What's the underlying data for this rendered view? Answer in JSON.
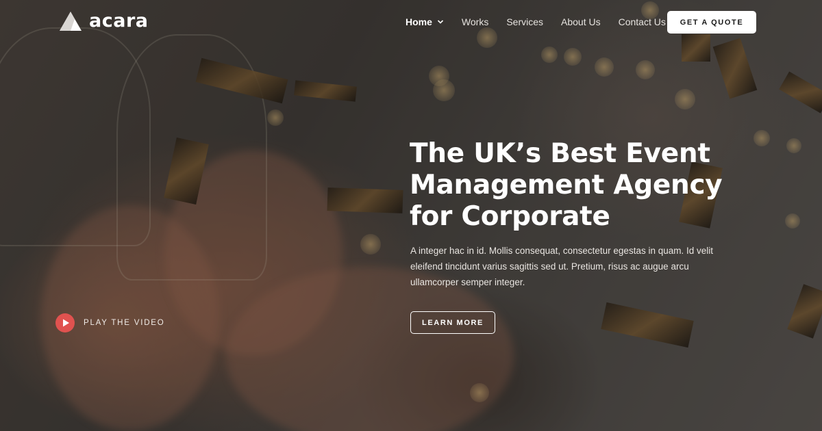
{
  "brand": {
    "name": "acara",
    "accent": "#e0524f"
  },
  "nav": {
    "items": [
      {
        "label": "Home",
        "active": true,
        "has_dropdown": true
      },
      {
        "label": "Works"
      },
      {
        "label": "Services"
      },
      {
        "label": "About Us"
      },
      {
        "label": "Contact Us"
      }
    ],
    "cta": "GET A QUOTE"
  },
  "hero": {
    "title_lines": [
      "The UK’s Best Event",
      "Management Agency",
      "for Corporate"
    ],
    "description": "A integer hac in id. Mollis consequat, consectetur egestas in quam. Id velit eleifend tincidunt varius sagittis sed ut. Pretium, risus ac augue arcu ullamcorper semper integer.",
    "cta": "LEARN MORE",
    "video_label": "PLAY THE VIDEO"
  },
  "icons": {
    "logo": "triangle-logo-icon",
    "dropdown": "chevron-down-icon",
    "play": "play-icon"
  }
}
